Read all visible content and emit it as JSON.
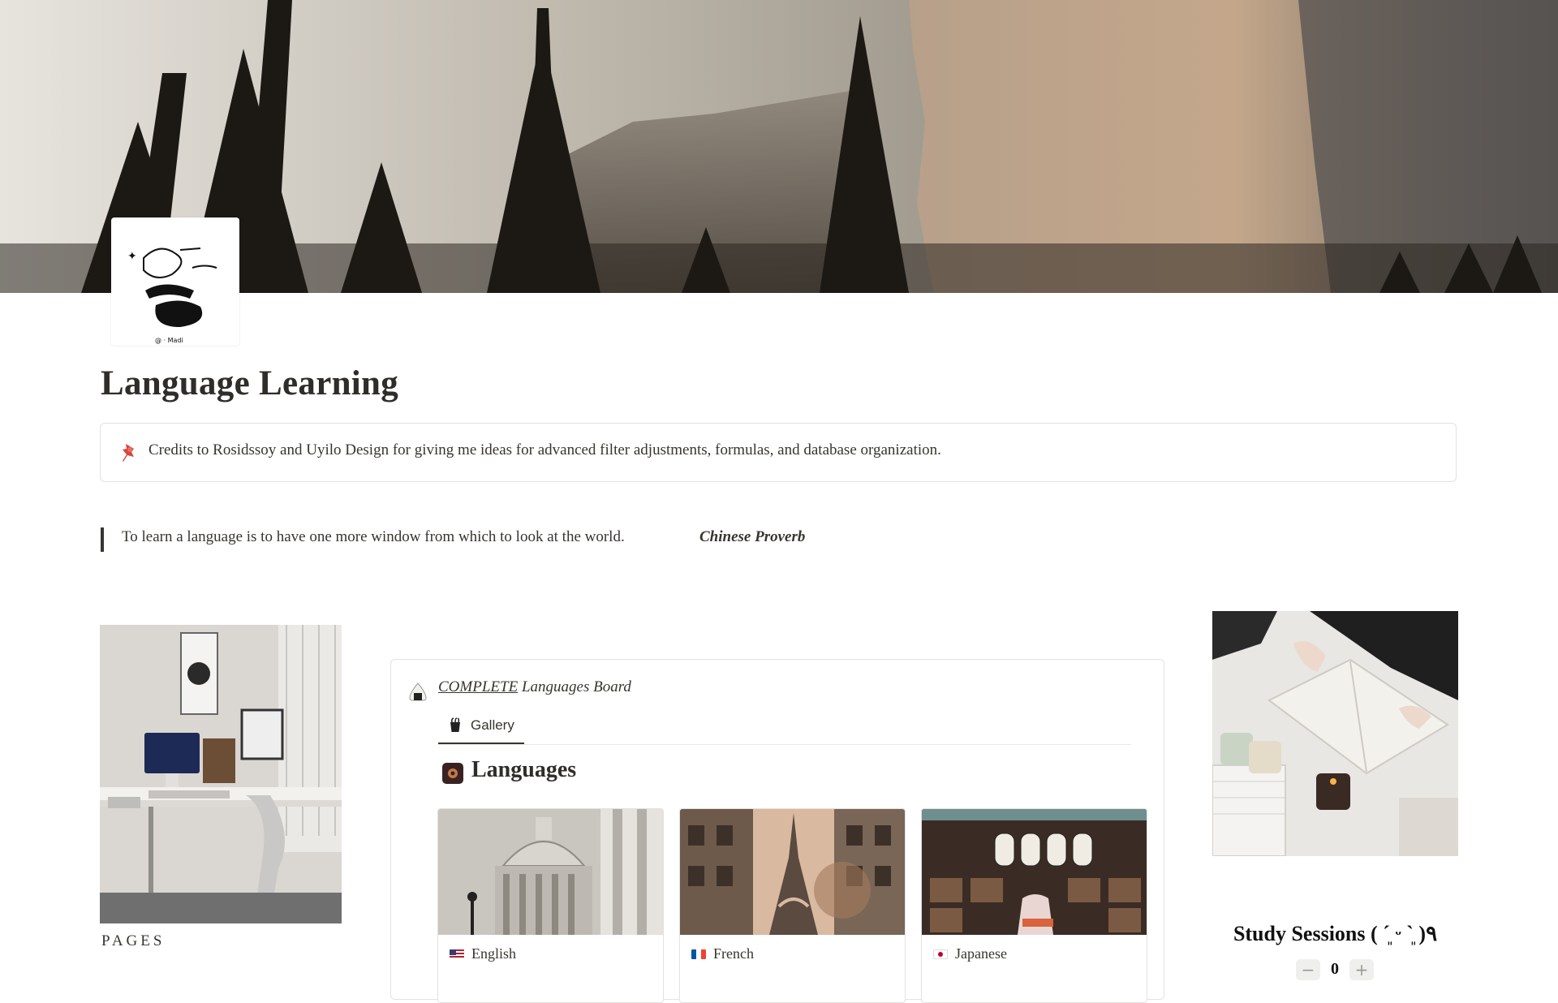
{
  "page": {
    "title": "Language Learning"
  },
  "callout": {
    "icon": "pushpin-icon",
    "text": "Credits to Rosidssoy and Uyilo Design for giving me ideas for advanced filter adjustments, formulas, and database organization."
  },
  "quote": {
    "text": "To learn a language is to have one more window from which to look at the world.",
    "author": "Chinese Proverb"
  },
  "left_column": {
    "pages_heading": "PAGES"
  },
  "database": {
    "title_underlined": "COMPLETE",
    "title_rest": " Languages  Board",
    "view_tab": {
      "label": "Gallery",
      "icon": "gallery-icon"
    },
    "section_title": "Languages",
    "cards": [
      {
        "label": "English",
        "flag": "us-flag-icon"
      },
      {
        "label": "French",
        "flag": "fr-flag-icon"
      },
      {
        "label": "Japanese",
        "flag": "jp-flag-icon"
      }
    ]
  },
  "right_column": {
    "study_sessions_title": "Study Sessions ( ˊ͈ ᵕ ˋ͈ )٩",
    "counter_value": "0",
    "decrement_label": "−",
    "increment_label": "+"
  },
  "colors": {
    "text": "#37352f",
    "border": "#e3e2e0",
    "button_bg": "#efefed"
  }
}
